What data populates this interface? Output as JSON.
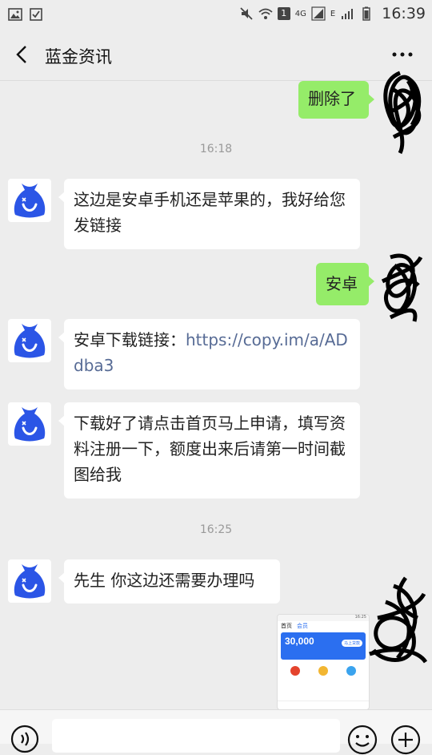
{
  "status_bar": {
    "time": "16:39",
    "notification_count": "1",
    "network_4g": "4G",
    "network_e": "E"
  },
  "header": {
    "title": "蓝金资讯"
  },
  "messages": [
    {
      "side": "out",
      "text": "删除了"
    },
    {
      "type": "time",
      "text": "16:18"
    },
    {
      "side": "in",
      "text": "这边是安卓手机还是苹果的，我好给您发链接"
    },
    {
      "side": "out",
      "text": "安卓"
    },
    {
      "side": "in",
      "prefix": "安卓下载链接：",
      "link": "https://copy.im/a/ADdba3"
    },
    {
      "side": "in",
      "text": "下载好了请点击首页马上申请，填写资料注册一下，额度出来后请第一时间截图给我"
    },
    {
      "type": "time",
      "text": "16:25"
    },
    {
      "side": "in",
      "text": "先生 你这边还需要办理吗"
    },
    {
      "side": "out",
      "type": "image"
    }
  ],
  "thumbnail": {
    "tab_home": "首页",
    "tab_member": "会员",
    "amount": "30,000",
    "apply_button": "马上贷款",
    "status_time": "16:25"
  },
  "colors": {
    "incoming_bubble": "#ffffff",
    "outgoing_bubble": "#95ec69",
    "link": "#576b95",
    "background": "#ededed",
    "avatar_blue": "#2b55e6"
  }
}
